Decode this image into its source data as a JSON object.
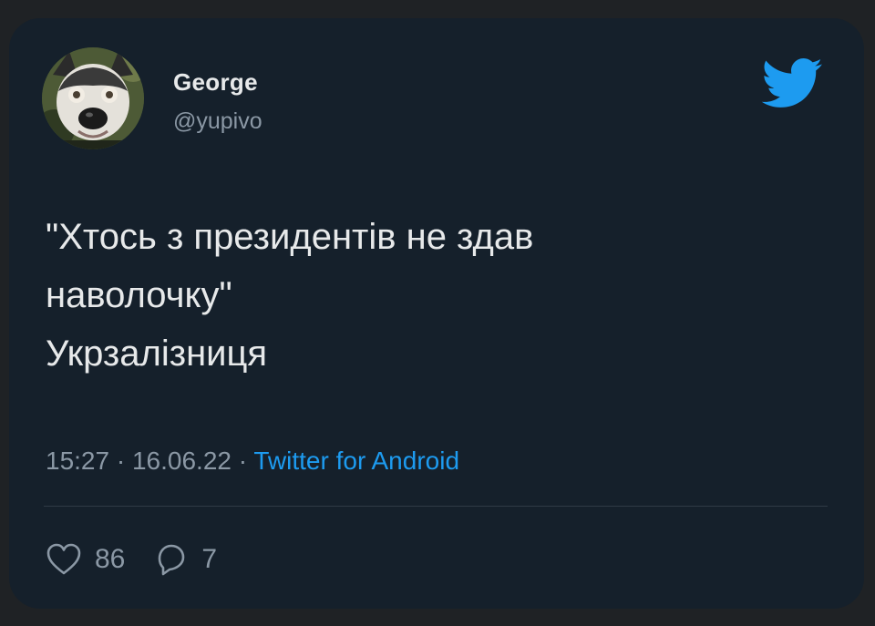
{
  "tweet": {
    "author": {
      "display_name": "George",
      "handle": "@yupivo",
      "avatar": "husky-dog-avatar"
    },
    "logo_icon": "twitter-bird-icon",
    "text_lines": [
      "\"Хтось з президентів не здав",
      "наволочку\"",
      "Укрзалізниця"
    ],
    "time": "15:27",
    "date": "16.06.22",
    "separator": "·",
    "source": "Twitter for Android",
    "likes": {
      "icon": "heart-icon",
      "count": "86"
    },
    "replies": {
      "icon": "comment-icon",
      "count": "7"
    }
  },
  "colors": {
    "background": "#15202b",
    "text": "#e7e9ea",
    "muted": "#8b98a5",
    "accent": "#1d9bf0"
  }
}
